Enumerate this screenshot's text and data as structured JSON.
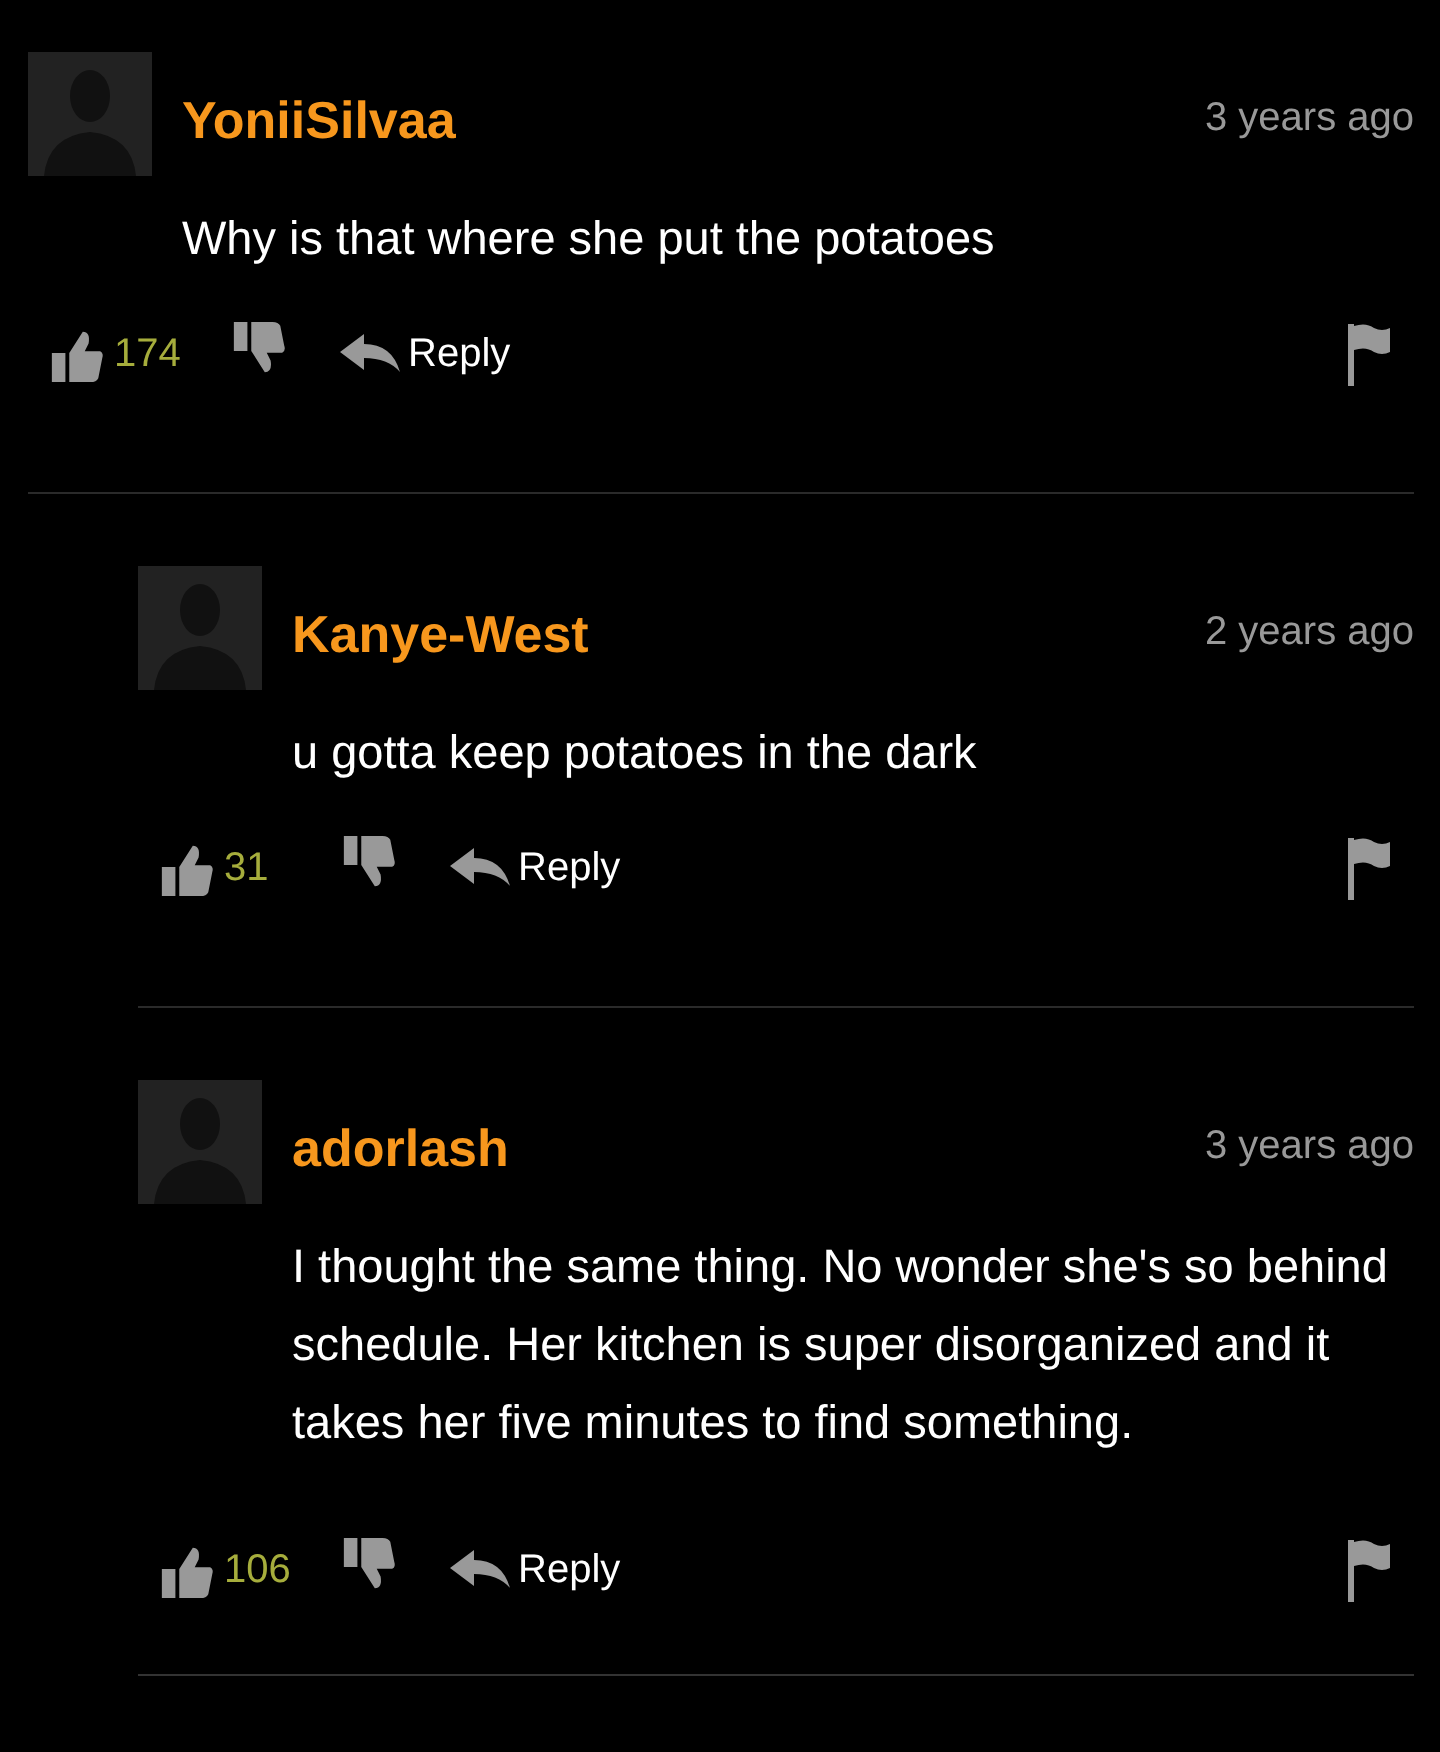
{
  "comments": [
    {
      "username": "YoniiSilvaa",
      "time": "3 years ago",
      "text": "Why is that where she put the potatoes",
      "likes": "174",
      "reply_label": "Reply",
      "children": [
        {
          "username": "Kanye-West",
          "time": "2 years ago",
          "text": "u gotta keep potatoes in the dark",
          "likes": "31",
          "reply_label": "Reply"
        },
        {
          "username": "adorlash",
          "time": "3 years ago",
          "text": "I thought the same thing. No wonder she's so behind schedule. Her kitchen is super disorganized and it takes her five minutes to find something.",
          "likes": "106",
          "reply_label": "Reply"
        }
      ]
    }
  ]
}
